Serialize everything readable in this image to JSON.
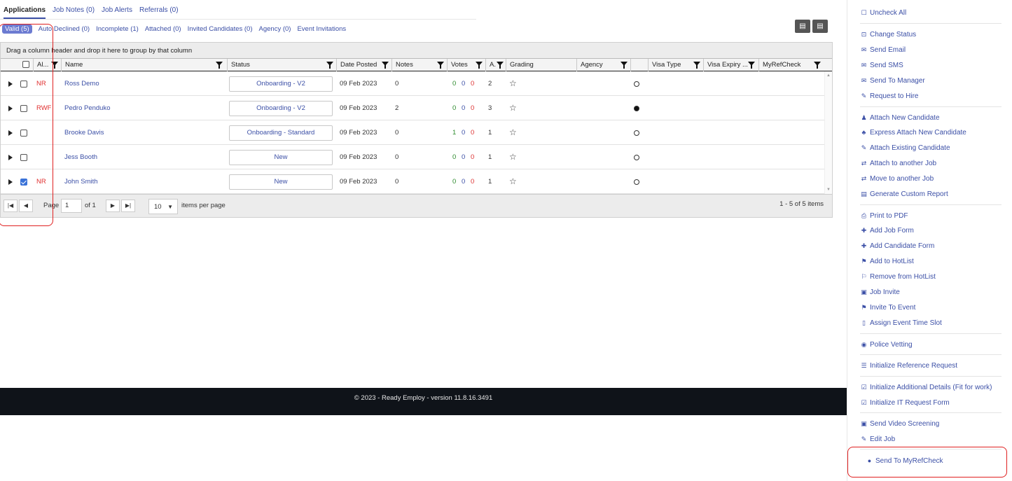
{
  "tabs": [
    "Applications",
    "Job Notes (0)",
    "Job Alerts",
    "Referrals (0)"
  ],
  "subtabs": [
    "Valid (5)",
    "Auto Declined (0)",
    "Incomplete (1)",
    "Attached (0)",
    "Invited Candidates (0)",
    "Agency (0)",
    "Event Invitations"
  ],
  "export_buttons": [
    "excel-export-icon",
    "pdf-export-icon"
  ],
  "grid": {
    "group_hint": "Drag a column header and drop it here to group by that column",
    "columns": [
      "Al...",
      "Name",
      "Status",
      "Date Posted",
      "Notes",
      "Votes",
      "A.",
      "Grading",
      "Agency",
      "",
      "Visa Type",
      "Visa Expiry ...",
      "MyRefCheck"
    ],
    "rows": [
      {
        "alert": "NR",
        "name": "Ross Demo",
        "status": "Onboarding - V2",
        "date": "09 Feb 2023",
        "notes": "0",
        "votes": [
          "0",
          "0",
          "0"
        ],
        "a": "2",
        "grading": "☆",
        "checked": false,
        "dot_filled": false
      },
      {
        "alert": "RWF",
        "name": "Pedro Penduko",
        "status": "Onboarding - V2",
        "date": "09 Feb 2023",
        "notes": "2",
        "votes": [
          "0",
          "0",
          "0"
        ],
        "a": "3",
        "grading": "☆",
        "checked": false,
        "dot_filled": true
      },
      {
        "alert": "",
        "name": "Brooke Davis",
        "status": "Onboarding - Standard",
        "date": "09 Feb 2023",
        "notes": "0",
        "votes": [
          "1",
          "0",
          "0"
        ],
        "a": "1",
        "grading": "☆",
        "checked": false,
        "dot_filled": false
      },
      {
        "alert": "",
        "name": "Jess Booth",
        "status": "New",
        "date": "09 Feb 2023",
        "notes": "0",
        "votes": [
          "0",
          "0",
          "0"
        ],
        "a": "1",
        "grading": "☆",
        "checked": false,
        "dot_filled": false
      },
      {
        "alert": "NR",
        "name": "John Smith",
        "status": "New",
        "date": "09 Feb 2023",
        "notes": "0",
        "votes": [
          "0",
          "0",
          "0"
        ],
        "a": "1",
        "grading": "☆",
        "checked": true,
        "dot_filled": false
      }
    ],
    "pager": {
      "page_label": "Page",
      "page_value": "1",
      "of_label": "of 1",
      "per_page": "10",
      "per_page_label": "items per page",
      "summary": "1 - 5 of 5 items"
    }
  },
  "footer": "© 2023 - Ready Employ - version 11.8.16.3491",
  "actions": [
    {
      "icon": "square-icon",
      "glyph": "☐",
      "label": "Uncheck All"
    },
    {
      "icon": "change-status-icon",
      "glyph": "⊡",
      "label": "Change Status"
    },
    {
      "icon": "envelope-icon",
      "glyph": "✉",
      "label": "Send Email"
    },
    {
      "icon": "envelope-icon",
      "glyph": "✉",
      "label": "Send SMS"
    },
    {
      "icon": "envelope-icon",
      "glyph": "✉",
      "label": "Send To Manager"
    },
    {
      "icon": "gavel-icon",
      "glyph": "✎",
      "label": "Request to Hire"
    },
    {
      "icon": "user-icon",
      "glyph": "♟",
      "label": "Attach New Candidate"
    },
    {
      "icon": "users-icon",
      "glyph": "♣",
      "label": "Express Attach New Candidate"
    },
    {
      "icon": "paperclip-icon",
      "glyph": "✎",
      "label": "Attach Existing Candidate"
    },
    {
      "icon": "exchange-icon",
      "glyph": "⇄",
      "label": "Attach to another Job"
    },
    {
      "icon": "exchange-icon",
      "glyph": "⇄",
      "label": "Move to another Job"
    },
    {
      "icon": "report-icon",
      "glyph": "▤",
      "label": "Generate Custom Report"
    },
    {
      "icon": "print-icon",
      "glyph": "⎙",
      "label": "Print to PDF"
    },
    {
      "icon": "plus-icon",
      "glyph": "✚",
      "label": "Add Job Form"
    },
    {
      "icon": "plus-icon",
      "glyph": "✚",
      "label": "Add Candidate Form"
    },
    {
      "icon": "flag-icon",
      "glyph": "⚑",
      "label": "Add to HotList"
    },
    {
      "icon": "flag-outline-icon",
      "glyph": "⚐",
      "label": "Remove from HotList"
    },
    {
      "icon": "briefcase-icon",
      "glyph": "▣",
      "label": "Job Invite"
    },
    {
      "icon": "flag-icon",
      "glyph": "⚑",
      "label": "Invite To Event"
    },
    {
      "icon": "mobile-icon",
      "glyph": "▯",
      "label": "Assign Event Time Slot"
    },
    {
      "icon": "eye-icon",
      "glyph": "◉",
      "label": "Police Vetting"
    },
    {
      "icon": "list-icon",
      "glyph": "☰",
      "label": "Initialize Reference Request"
    },
    {
      "icon": "check-square-icon",
      "glyph": "☑",
      "label": "Initialize Additional Details (Fit for work)"
    },
    {
      "icon": "check-square-icon",
      "glyph": "☑",
      "label": "Initialize IT Request Form"
    },
    {
      "icon": "video-icon",
      "glyph": "▣",
      "label": "Send Video Screening"
    },
    {
      "icon": "edit-icon",
      "glyph": "✎",
      "label": "Edit Job"
    },
    {
      "icon": "apple-icon",
      "glyph": "●",
      "label": "Send To MyRefCheck"
    }
  ]
}
